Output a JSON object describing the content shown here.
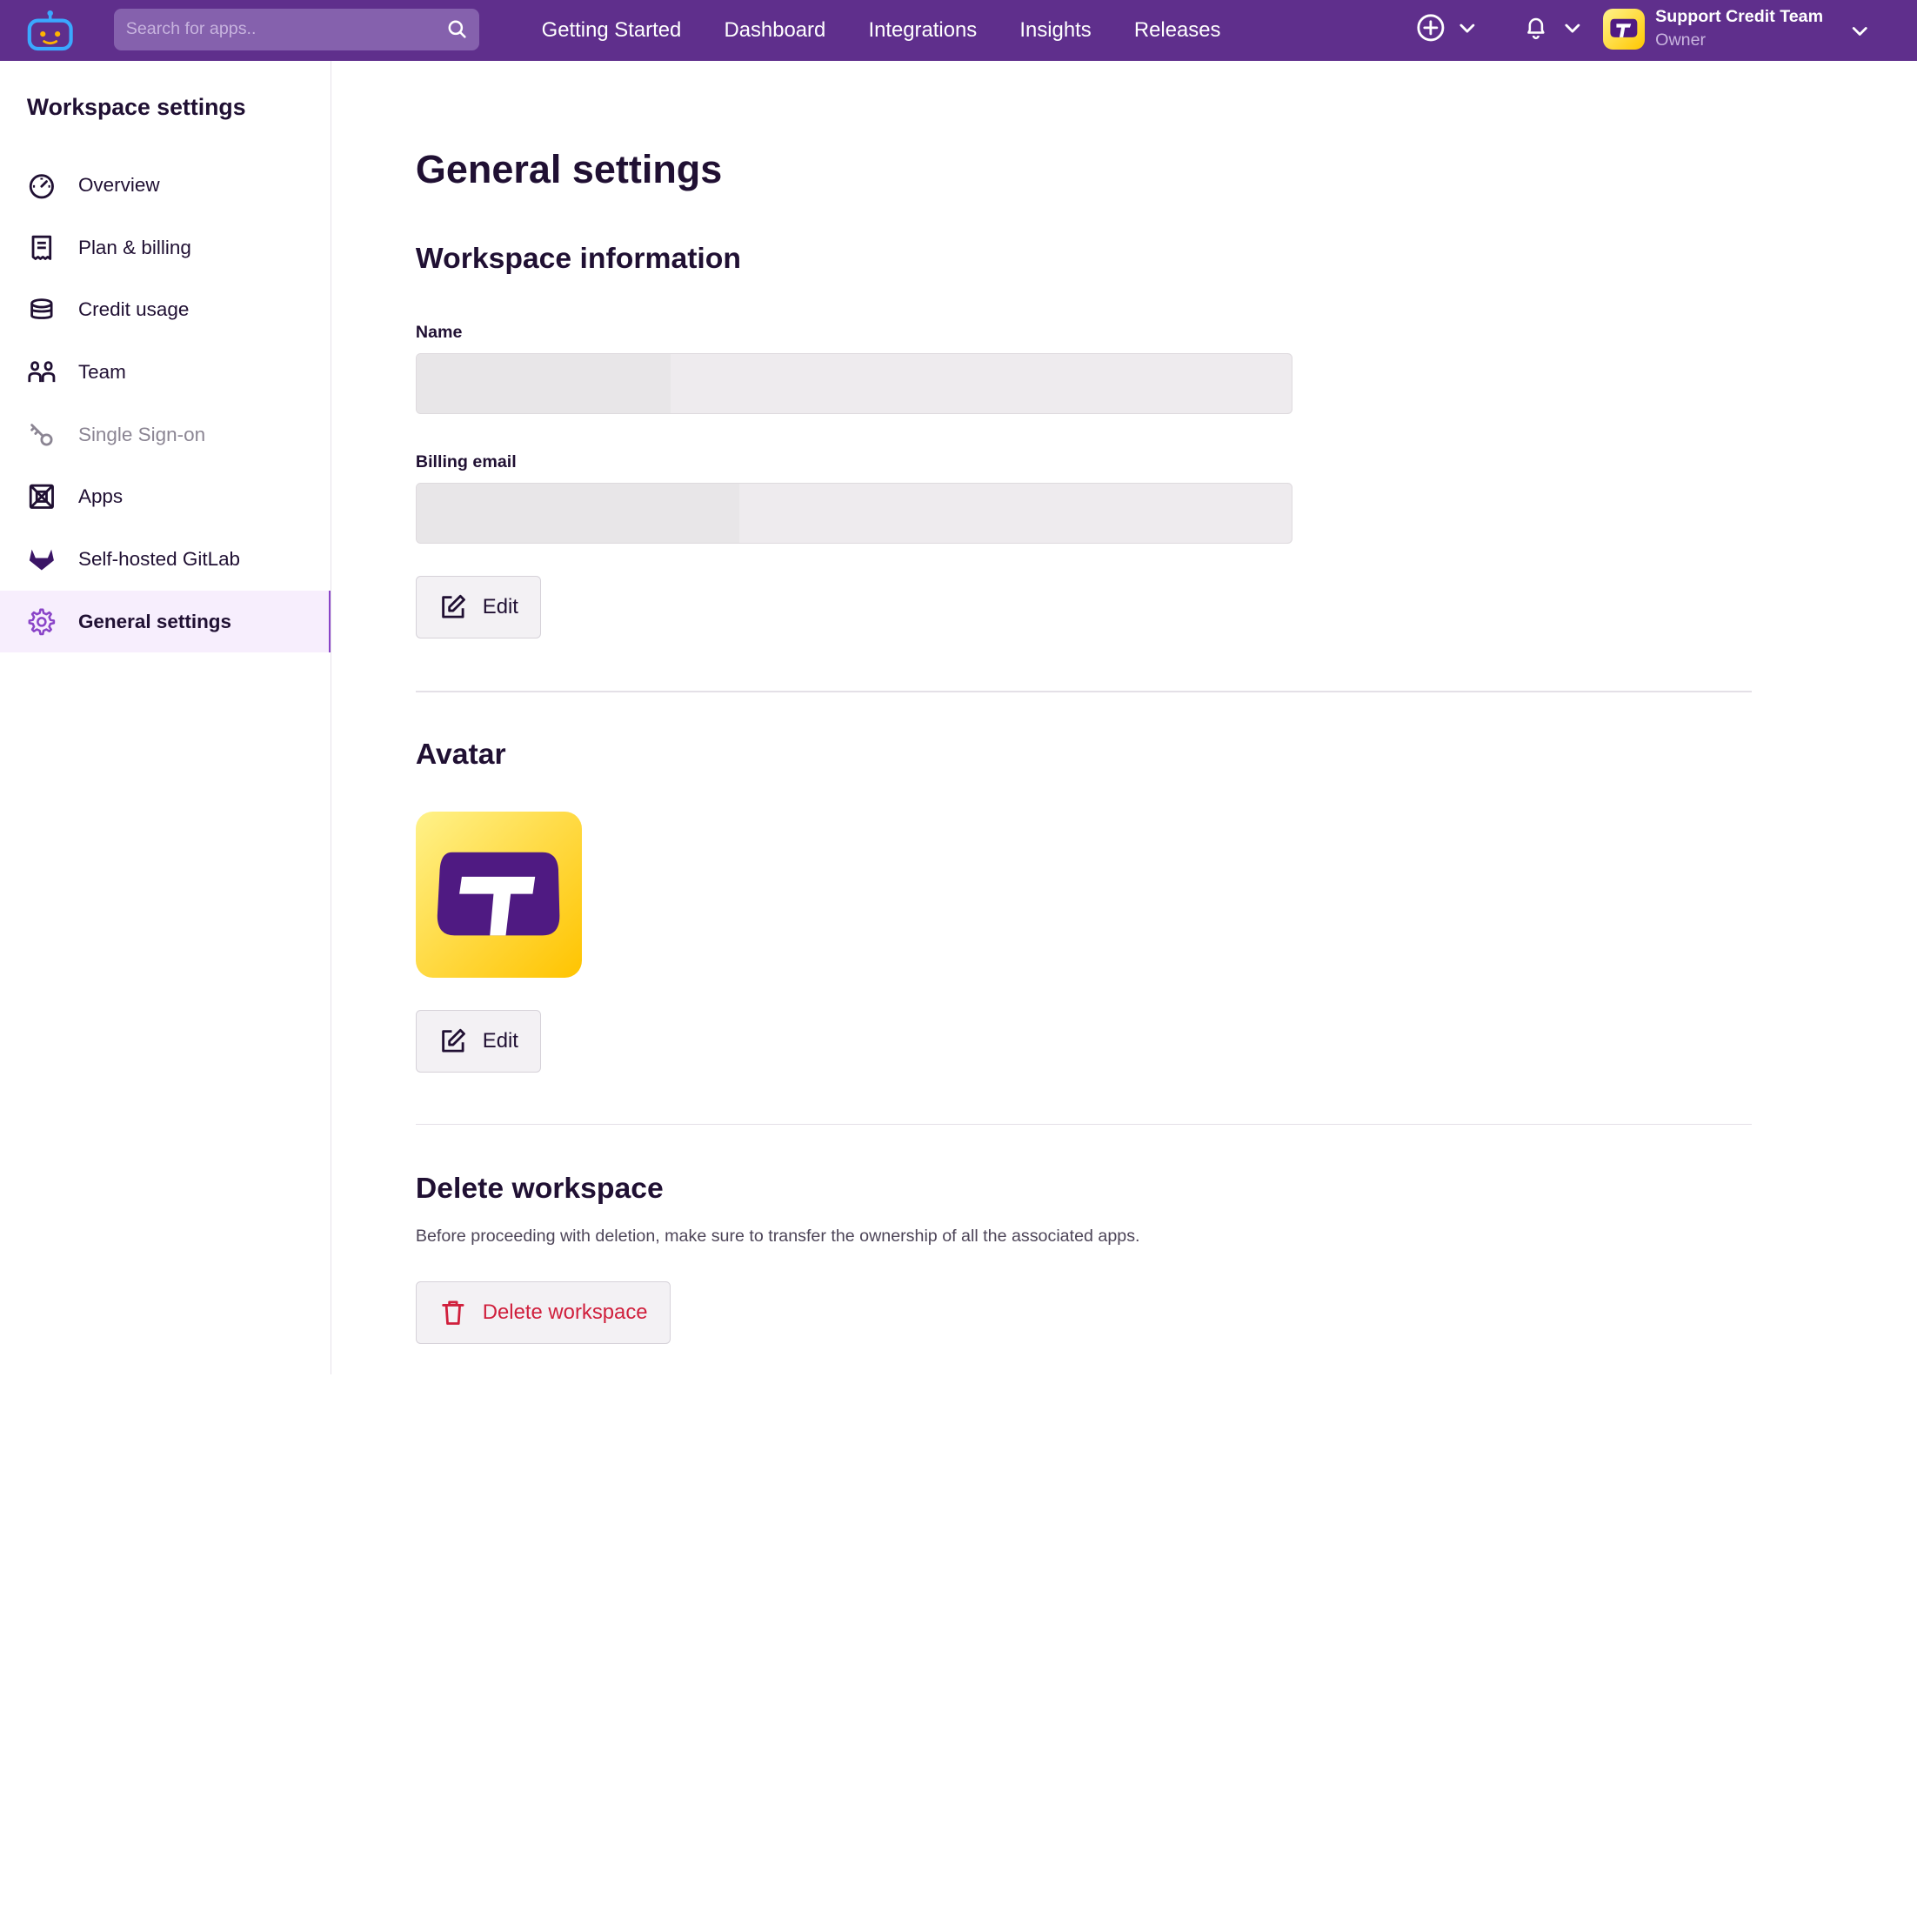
{
  "header": {
    "search_placeholder": "Search for apps..",
    "nav": [
      "Getting Started",
      "Dashboard",
      "Integrations",
      "Insights",
      "Releases"
    ],
    "account": {
      "name": "Support Credit Team",
      "role": "Owner"
    }
  },
  "sidebar": {
    "title": "Workspace settings",
    "items": [
      {
        "label": "Overview",
        "icon": "gauge-icon"
      },
      {
        "label": "Plan & billing",
        "icon": "receipt-icon"
      },
      {
        "label": "Credit usage",
        "icon": "coins-stack-icon"
      },
      {
        "label": "Team",
        "icon": "team-icon"
      },
      {
        "label": "Single Sign-on",
        "icon": "key-icon",
        "disabled": true
      },
      {
        "label": "Apps",
        "icon": "apps-icon"
      },
      {
        "label": "Self-hosted GitLab",
        "icon": "gitlab-icon"
      },
      {
        "label": "General settings",
        "icon": "gear-icon",
        "active": true
      }
    ]
  },
  "main": {
    "title": "General settings",
    "workspace_info": {
      "heading": "Workspace information",
      "name_label": "Name",
      "billing_label": "Billing email",
      "edit_label": "Edit"
    },
    "avatar": {
      "heading": "Avatar",
      "edit_label": "Edit"
    },
    "delete": {
      "heading": "Delete workspace",
      "description": "Before proceeding with deletion, make sure to transfer the ownership of all the associated apps.",
      "button_label": "Delete workspace"
    }
  },
  "colors": {
    "brand_purple": "#5f2f8c",
    "active_accent": "#8a44c8",
    "danger": "#d01f3c",
    "avatar_yellow": "#ffc700"
  }
}
